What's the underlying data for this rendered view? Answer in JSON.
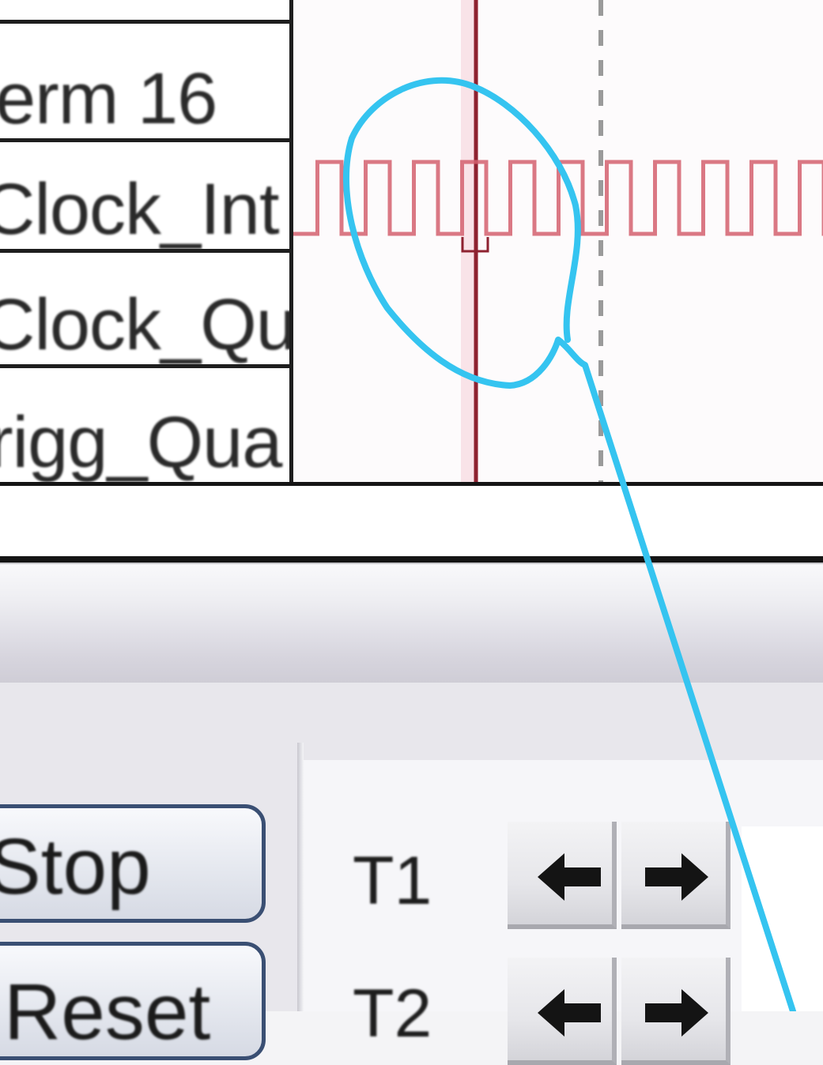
{
  "signals": [
    {
      "label": ""
    },
    {
      "label": "erm 16"
    },
    {
      "label": "Clock_Int"
    },
    {
      "label": "Clock_Qua"
    },
    {
      "label": "rigg_Qua"
    }
  ],
  "controls": {
    "stop_label": "Stop",
    "reset_label": "Reset",
    "t1_label": "T1",
    "t2_label": "T2"
  },
  "icons": {
    "left": "arrow-left-icon",
    "right": "arrow-right-icon"
  },
  "colors": {
    "waveform": "#d4606e",
    "cursor_line": "#8e2230",
    "annotation": "#35c4f0"
  }
}
